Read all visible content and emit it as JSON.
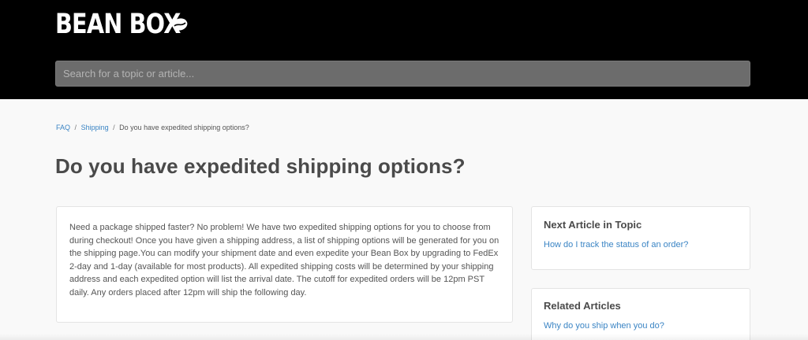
{
  "header": {
    "logo_text": "BEAN BOX",
    "logo_icon": "coffee-bean-icon",
    "background_color": "#000000"
  },
  "search": {
    "placeholder": "Search for a topic or article..."
  },
  "breadcrumb": {
    "items": [
      "FAQ",
      "Shipping",
      "Do you have expedited shipping options?"
    ],
    "separator": "/"
  },
  "article": {
    "title": "Do you have expedited shipping options?",
    "body": "Need a package shipped faster? No problem! We have two expedited shipping options for you to choose from during checkout! Once you have given a shipping address, a list of shipping options will be generated for you on the shipping page.You can modify your shipment date and even expedite your Bean Box by upgrading to FedEx 2-day and 1-day (available for most products). All expedited shipping costs will be determined by your shipping address and each expedited option will list the arrival date. The cutoff for expedited orders will be 12pm PST daily. Any orders placed after 12pm will ship the following day."
  },
  "sidebar": {
    "next_article": {
      "heading": "Next Article in Topic",
      "link": "How do I track the status of an order?"
    },
    "related_articles": {
      "heading": "Related Articles",
      "links": [
        "Why do you ship when you do?"
      ]
    }
  },
  "colors": {
    "link": "#3a84c4",
    "title": "#4a4a4a",
    "page_bg": "#f9f9f9"
  }
}
